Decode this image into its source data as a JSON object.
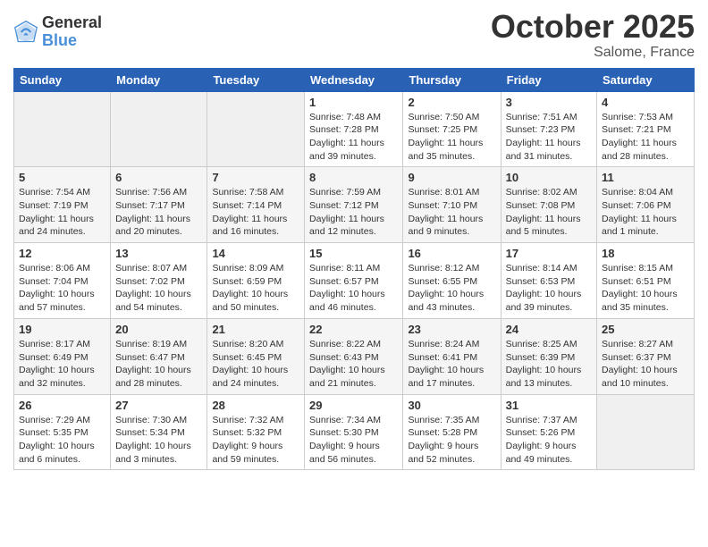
{
  "logo": {
    "general": "General",
    "blue": "Blue"
  },
  "title": {
    "month": "October 2025",
    "location": "Salome, France"
  },
  "weekdays": [
    "Sunday",
    "Monday",
    "Tuesday",
    "Wednesday",
    "Thursday",
    "Friday",
    "Saturday"
  ],
  "weeks": [
    [
      {
        "day": "",
        "info": ""
      },
      {
        "day": "",
        "info": ""
      },
      {
        "day": "",
        "info": ""
      },
      {
        "day": "1",
        "info": "Sunrise: 7:48 AM\nSunset: 7:28 PM\nDaylight: 11 hours\nand 39 minutes."
      },
      {
        "day": "2",
        "info": "Sunrise: 7:50 AM\nSunset: 7:25 PM\nDaylight: 11 hours\nand 35 minutes."
      },
      {
        "day": "3",
        "info": "Sunrise: 7:51 AM\nSunset: 7:23 PM\nDaylight: 11 hours\nand 31 minutes."
      },
      {
        "day": "4",
        "info": "Sunrise: 7:53 AM\nSunset: 7:21 PM\nDaylight: 11 hours\nand 28 minutes."
      }
    ],
    [
      {
        "day": "5",
        "info": "Sunrise: 7:54 AM\nSunset: 7:19 PM\nDaylight: 11 hours\nand 24 minutes."
      },
      {
        "day": "6",
        "info": "Sunrise: 7:56 AM\nSunset: 7:17 PM\nDaylight: 11 hours\nand 20 minutes."
      },
      {
        "day": "7",
        "info": "Sunrise: 7:58 AM\nSunset: 7:14 PM\nDaylight: 11 hours\nand 16 minutes."
      },
      {
        "day": "8",
        "info": "Sunrise: 7:59 AM\nSunset: 7:12 PM\nDaylight: 11 hours\nand 12 minutes."
      },
      {
        "day": "9",
        "info": "Sunrise: 8:01 AM\nSunset: 7:10 PM\nDaylight: 11 hours\nand 9 minutes."
      },
      {
        "day": "10",
        "info": "Sunrise: 8:02 AM\nSunset: 7:08 PM\nDaylight: 11 hours\nand 5 minutes."
      },
      {
        "day": "11",
        "info": "Sunrise: 8:04 AM\nSunset: 7:06 PM\nDaylight: 11 hours\nand 1 minute."
      }
    ],
    [
      {
        "day": "12",
        "info": "Sunrise: 8:06 AM\nSunset: 7:04 PM\nDaylight: 10 hours\nand 57 minutes."
      },
      {
        "day": "13",
        "info": "Sunrise: 8:07 AM\nSunset: 7:02 PM\nDaylight: 10 hours\nand 54 minutes."
      },
      {
        "day": "14",
        "info": "Sunrise: 8:09 AM\nSunset: 6:59 PM\nDaylight: 10 hours\nand 50 minutes."
      },
      {
        "day": "15",
        "info": "Sunrise: 8:11 AM\nSunset: 6:57 PM\nDaylight: 10 hours\nand 46 minutes."
      },
      {
        "day": "16",
        "info": "Sunrise: 8:12 AM\nSunset: 6:55 PM\nDaylight: 10 hours\nand 43 minutes."
      },
      {
        "day": "17",
        "info": "Sunrise: 8:14 AM\nSunset: 6:53 PM\nDaylight: 10 hours\nand 39 minutes."
      },
      {
        "day": "18",
        "info": "Sunrise: 8:15 AM\nSunset: 6:51 PM\nDaylight: 10 hours\nand 35 minutes."
      }
    ],
    [
      {
        "day": "19",
        "info": "Sunrise: 8:17 AM\nSunset: 6:49 PM\nDaylight: 10 hours\nand 32 minutes."
      },
      {
        "day": "20",
        "info": "Sunrise: 8:19 AM\nSunset: 6:47 PM\nDaylight: 10 hours\nand 28 minutes."
      },
      {
        "day": "21",
        "info": "Sunrise: 8:20 AM\nSunset: 6:45 PM\nDaylight: 10 hours\nand 24 minutes."
      },
      {
        "day": "22",
        "info": "Sunrise: 8:22 AM\nSunset: 6:43 PM\nDaylight: 10 hours\nand 21 minutes."
      },
      {
        "day": "23",
        "info": "Sunrise: 8:24 AM\nSunset: 6:41 PM\nDaylight: 10 hours\nand 17 minutes."
      },
      {
        "day": "24",
        "info": "Sunrise: 8:25 AM\nSunset: 6:39 PM\nDaylight: 10 hours\nand 13 minutes."
      },
      {
        "day": "25",
        "info": "Sunrise: 8:27 AM\nSunset: 6:37 PM\nDaylight: 10 hours\nand 10 minutes."
      }
    ],
    [
      {
        "day": "26",
        "info": "Sunrise: 7:29 AM\nSunset: 5:35 PM\nDaylight: 10 hours\nand 6 minutes."
      },
      {
        "day": "27",
        "info": "Sunrise: 7:30 AM\nSunset: 5:34 PM\nDaylight: 10 hours\nand 3 minutes."
      },
      {
        "day": "28",
        "info": "Sunrise: 7:32 AM\nSunset: 5:32 PM\nDaylight: 9 hours\nand 59 minutes."
      },
      {
        "day": "29",
        "info": "Sunrise: 7:34 AM\nSunset: 5:30 PM\nDaylight: 9 hours\nand 56 minutes."
      },
      {
        "day": "30",
        "info": "Sunrise: 7:35 AM\nSunset: 5:28 PM\nDaylight: 9 hours\nand 52 minutes."
      },
      {
        "day": "31",
        "info": "Sunrise: 7:37 AM\nSunset: 5:26 PM\nDaylight: 9 hours\nand 49 minutes."
      },
      {
        "day": "",
        "info": ""
      }
    ]
  ]
}
